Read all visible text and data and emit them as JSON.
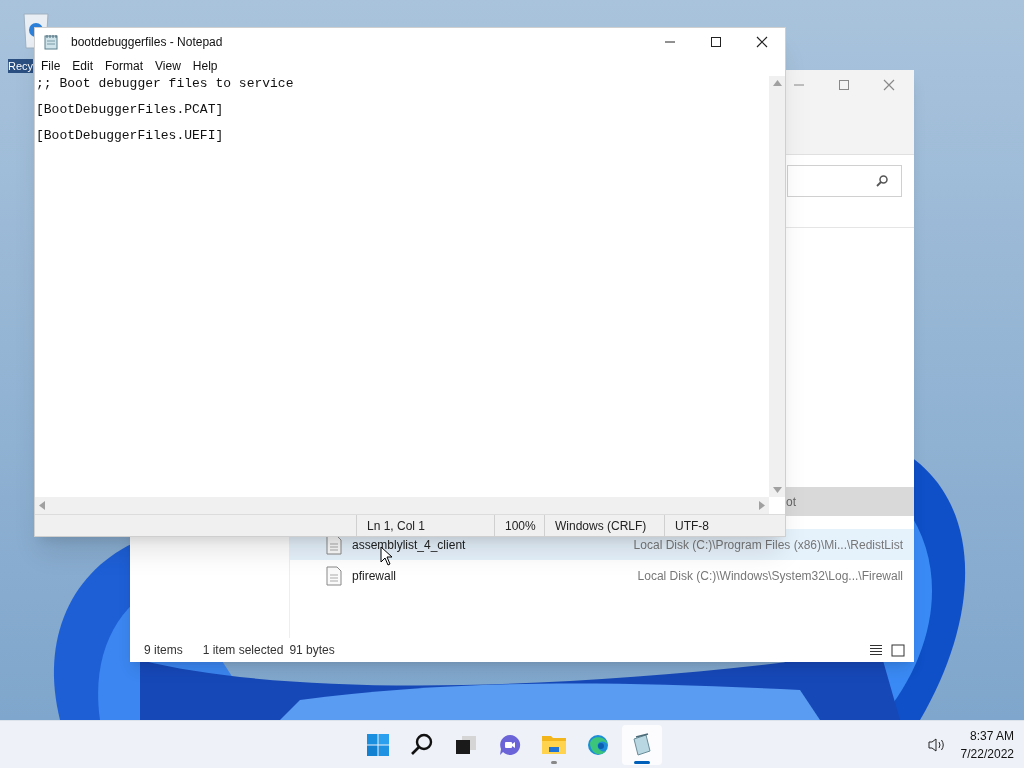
{
  "desktop_icons": [
    {
      "label": "Recy"
    }
  ],
  "explorer": {
    "header_text": "ot",
    "files": [
      {
        "name": "assemblylist_4_client",
        "location": "Local Disk (C:)\\Program Files (x86)\\Mi...\\RedistList",
        "selected": true
      },
      {
        "name": "pfirewall",
        "location": "Local Disk (C:)\\Windows\\System32\\Log...\\Firewall",
        "selected": false
      }
    ],
    "status": {
      "items": "9 items",
      "selection": "1 item selected",
      "size": "91 bytes"
    }
  },
  "notepad": {
    "title": "bootdebuggerfiles - Notepad",
    "menu": [
      "File",
      "Edit",
      "Format",
      "View",
      "Help"
    ],
    "lines": [
      ";; Boot debugger files to service",
      "[BootDebuggerFiles.PCAT]",
      "[BootDebuggerFiles.UEFI]"
    ],
    "status": [
      "Ln 1, Col 1",
      "100%",
      "Windows (CRLF)",
      "UTF-8"
    ]
  },
  "taskbar": {
    "apps": [
      {
        "kind": "start",
        "running": false,
        "selected": false
      },
      {
        "kind": "search",
        "running": false,
        "selected": false
      },
      {
        "kind": "taskview",
        "running": false,
        "selected": false
      },
      {
        "kind": "chat",
        "running": false,
        "selected": false
      },
      {
        "kind": "explorer",
        "running": true,
        "selected": false
      },
      {
        "kind": "edge",
        "running": false,
        "selected": false
      },
      {
        "kind": "notepad",
        "running": true,
        "selected": true
      }
    ],
    "clock": {
      "time": "8:37 AM",
      "date": "7/22/2022"
    }
  }
}
